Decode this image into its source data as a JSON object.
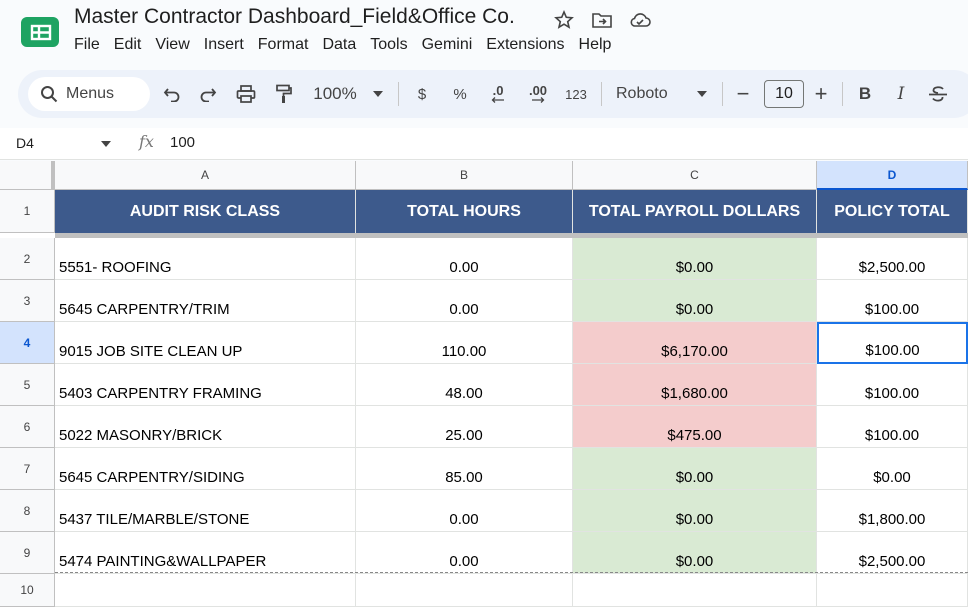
{
  "app": {
    "title": "Master Contractor Dashboard_Field&Office Co.",
    "menus": [
      "File",
      "Edit",
      "View",
      "Insert",
      "Format",
      "Data",
      "Tools",
      "Gemini",
      "Extensions",
      "Help"
    ]
  },
  "toolbar": {
    "search_label": "Menus",
    "zoom": "100%",
    "currency": "$",
    "percent": "%",
    "decrease_decimal": ".0",
    "increase_decimal": ".00",
    "more_formats": "123",
    "font": "Roboto",
    "font_size": "10",
    "minus": "−",
    "plus": "+",
    "bold": "B",
    "italic": "I"
  },
  "formula_bar": {
    "cell_ref": "D4",
    "fx": "fx",
    "value": "100"
  },
  "columns": [
    "A",
    "B",
    "C",
    "D"
  ],
  "header_row": {
    "row_number": "1",
    "cells": [
      "AUDIT RISK CLASS",
      "TOTAL HOURS",
      "TOTAL PAYROLL DOLLARS",
      "POLICY TOTAL"
    ]
  },
  "rows": [
    {
      "row": "2",
      "class": "5551- ROOFING",
      "hours": "0.00",
      "payroll": "$0.00",
      "payroll_status": "green",
      "policy": "$2,500.00"
    },
    {
      "row": "3",
      "class": "5645 CARPENTRY/TRIM",
      "hours": "0.00",
      "payroll": "$0.00",
      "payroll_status": "green",
      "policy": "$100.00"
    },
    {
      "row": "4",
      "class": "9015 JOB SITE CLEAN UP",
      "hours": "110.00",
      "payroll": "$6,170.00",
      "payroll_status": "red",
      "policy": "$100.00"
    },
    {
      "row": "5",
      "class": "5403 CARPENTRY FRAMING",
      "hours": "48.00",
      "payroll": "$1,680.00",
      "payroll_status": "red",
      "policy": "$100.00"
    },
    {
      "row": "6",
      "class": "5022 MASONRY/BRICK",
      "hours": "25.00",
      "payroll": "$475.00",
      "payroll_status": "red",
      "policy": "$100.00"
    },
    {
      "row": "7",
      "class": "5645 CARPENTRY/SIDING",
      "hours": "85.00",
      "payroll": "$0.00",
      "payroll_status": "green",
      "policy": "$0.00"
    },
    {
      "row": "8",
      "class": "5437 TILE/MARBLE/STONE",
      "hours": "0.00",
      "payroll": "$0.00",
      "payroll_status": "green",
      "policy": "$1,800.00"
    },
    {
      "row": "9",
      "class": "5474 PAINTING&WALLPAPER",
      "hours": "0.00",
      "payroll": "$0.00",
      "payroll_status": "green",
      "policy": "$2,500.00"
    }
  ],
  "empty_row": "10",
  "selected": {
    "column": "D",
    "row": "4"
  },
  "colors": {
    "header_fill": "#3d5a8c",
    "green_fill": "#d9ead3",
    "red_fill": "#f4cccc",
    "selection": "#1a73e8"
  }
}
